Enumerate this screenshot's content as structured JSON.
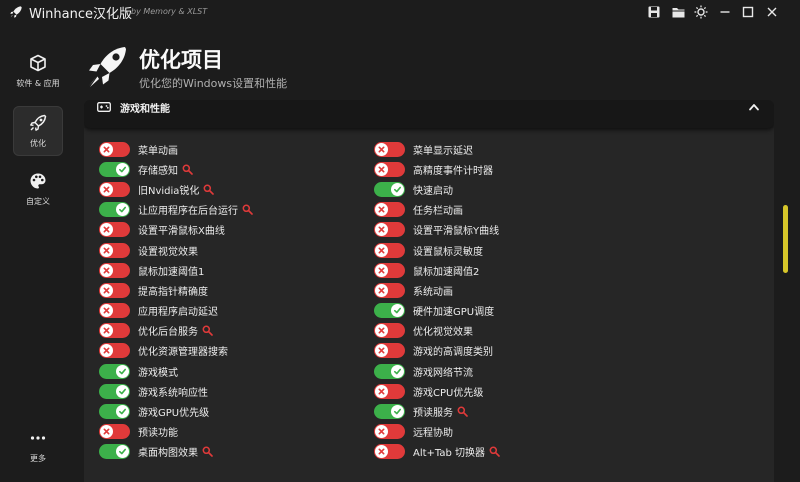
{
  "window": {
    "title": "Winhance汉化版",
    "subtitle": "by Memory & XLST"
  },
  "sidebar": {
    "items": [
      {
        "label": "软件 & 应用",
        "icon": "cube-icon"
      },
      {
        "label": "优化",
        "icon": "rocket-icon",
        "active": true
      },
      {
        "label": "自定义",
        "icon": "palette-icon"
      },
      {
        "label": "更多",
        "icon": "more-icon"
      }
    ]
  },
  "header": {
    "title": "优化项目",
    "subtitle": "优化您的Windows设置和性能"
  },
  "section": {
    "title": "游戏和性能"
  },
  "colors": {
    "on": "#3cb04a",
    "off": "#e03a3a",
    "scroll_thumb": "#d6c62a",
    "search_mark": "#e03a3a"
  },
  "settings": {
    "left": [
      {
        "label": "菜单动画",
        "on": false,
        "search": false
      },
      {
        "label": "存储感知",
        "on": true,
        "search": true
      },
      {
        "label": "旧Nvidia锐化",
        "on": false,
        "search": true
      },
      {
        "label": "让应用程序在后台运行",
        "on": true,
        "search": true
      },
      {
        "label": "设置平滑鼠标X曲线",
        "on": false,
        "search": false
      },
      {
        "label": "设置视觉效果",
        "on": false,
        "search": false
      },
      {
        "label": "鼠标加速阈值1",
        "on": false,
        "search": false
      },
      {
        "label": "提高指针精确度",
        "on": false,
        "search": false
      },
      {
        "label": "应用程序启动延迟",
        "on": false,
        "search": false
      },
      {
        "label": "优化后台服务",
        "on": false,
        "search": true
      },
      {
        "label": "优化资源管理器搜索",
        "on": false,
        "search": false
      },
      {
        "label": "游戏模式",
        "on": true,
        "search": false
      },
      {
        "label": "游戏系统响应性",
        "on": true,
        "search": false
      },
      {
        "label": "游戏GPU优先级",
        "on": true,
        "search": false
      },
      {
        "label": "预读功能",
        "on": false,
        "search": false
      },
      {
        "label": "桌面构图效果",
        "on": true,
        "search": true
      }
    ],
    "right": [
      {
        "label": "菜单显示延迟",
        "on": false,
        "search": false
      },
      {
        "label": "高精度事件计时器",
        "on": false,
        "search": false
      },
      {
        "label": "快速启动",
        "on": true,
        "search": false
      },
      {
        "label": "任务栏动画",
        "on": false,
        "search": false
      },
      {
        "label": "设置平滑鼠标Y曲线",
        "on": false,
        "search": false
      },
      {
        "label": "设置鼠标灵敏度",
        "on": false,
        "search": false
      },
      {
        "label": "鼠标加速阈值2",
        "on": false,
        "search": false
      },
      {
        "label": "系统动画",
        "on": false,
        "search": false
      },
      {
        "label": "硬件加速GPU调度",
        "on": true,
        "search": false
      },
      {
        "label": "优化视觉效果",
        "on": false,
        "search": false
      },
      {
        "label": "游戏的高调度类别",
        "on": false,
        "search": false
      },
      {
        "label": "游戏网络节流",
        "on": true,
        "search": false
      },
      {
        "label": "游戏CPU优先级",
        "on": false,
        "search": false
      },
      {
        "label": "预读服务",
        "on": true,
        "search": true
      },
      {
        "label": "远程协助",
        "on": false,
        "search": false
      },
      {
        "label": "Alt+Tab 切换器",
        "on": false,
        "search": true
      }
    ]
  }
}
